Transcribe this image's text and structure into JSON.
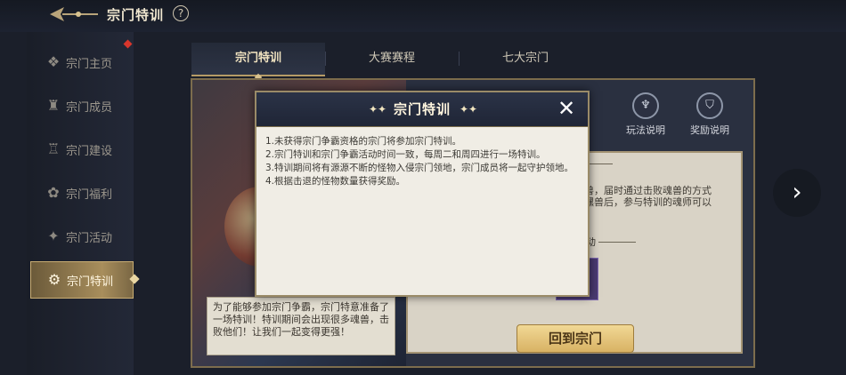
{
  "header": {
    "title": "宗门特训",
    "help": "?"
  },
  "sidebar": {
    "items": [
      {
        "label": "宗门主页",
        "icon": "❖"
      },
      {
        "label": "宗门成员",
        "icon": "♜"
      },
      {
        "label": "宗门建设",
        "icon": "♖"
      },
      {
        "label": "宗门福利",
        "icon": "✿"
      },
      {
        "label": "宗门活动",
        "icon": "✦"
      },
      {
        "label": "宗门特训",
        "icon": "⚙"
      }
    ]
  },
  "tabs": [
    {
      "label": "宗门特训"
    },
    {
      "label": "大赛赛程"
    },
    {
      "label": "七大宗门"
    }
  ],
  "buttons": {
    "gameplay": "玩法说明",
    "reward": "奖励说明",
    "return": "回到宗门"
  },
  "panel_text": {
    "line1": "个",
    "line2": "兽，届时通过击败魂兽的方式\n嘿兽后，参与特训的魂师可以",
    "line3": "动"
  },
  "speech": "为了能够参加宗门争霸，宗门特意准备了一场特训！特训期间会出现很多魂兽，击败他们！让我们一起变得更强！",
  "modal": {
    "title": "宗门特训",
    "rules": [
      "1.未获得宗门争霸资格的宗门将参加宗门特训。",
      "2.宗门特训和宗门争霸活动时间一致，每周二和周四进行一场特训。",
      "3.特训期间将有源源不断的怪物入侵宗门领地，宗门成员将一起守护领地。",
      "4.根据击退的怪物数量获得奖励。"
    ]
  }
}
